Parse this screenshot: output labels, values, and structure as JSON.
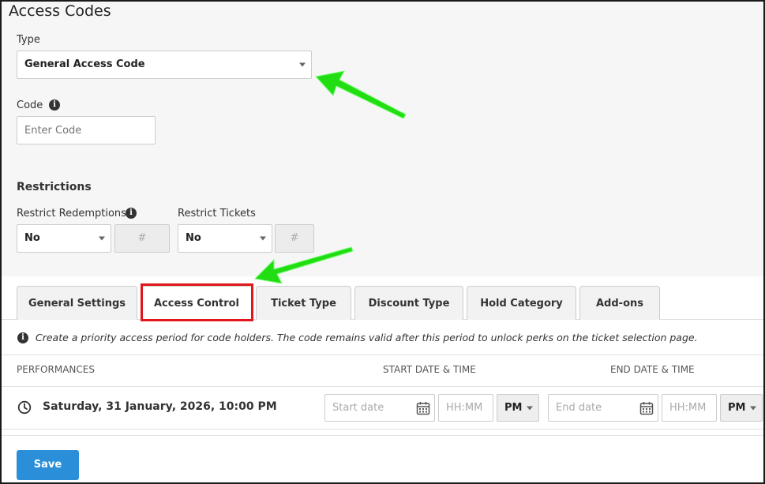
{
  "page": {
    "title": "Access Codes"
  },
  "type_field": {
    "label": "Type",
    "value": "General Access Code"
  },
  "code_field": {
    "label": "Code",
    "placeholder": "Enter Code",
    "info_icon": "i"
  },
  "restrictions": {
    "heading": "Restrictions",
    "redemptions": {
      "label": "Restrict Redemptions",
      "value": "No",
      "count_placeholder": "#",
      "info_icon": "i"
    },
    "tickets": {
      "label": "Restrict Tickets",
      "value": "No",
      "count_placeholder": "#"
    }
  },
  "tabs": [
    {
      "label": "General Settings"
    },
    {
      "label": "Access Control"
    },
    {
      "label": "Ticket Type"
    },
    {
      "label": "Discount Type"
    },
    {
      "label": "Hold Category"
    },
    {
      "label": "Add-ons"
    }
  ],
  "notice": {
    "icon": "i",
    "text": "Create a priority access period for code holders. The code remains valid after this period to unlock perks on the ticket selection page."
  },
  "table": {
    "headers": {
      "performances": "PERFORMANCES",
      "start": "START DATE & TIME",
      "end": "END DATE & TIME"
    },
    "row": {
      "performance": "Saturday, 31 January, 2026, 10:00 PM",
      "start_date_placeholder": "Start date",
      "start_time_placeholder": "HH:MM",
      "start_ampm": "PM",
      "end_date_placeholder": "End date",
      "end_time_placeholder": "HH:MM",
      "end_ampm": "PM"
    }
  },
  "save_button": {
    "label": "Save"
  },
  "colors": {
    "accent": "#2a8fd8",
    "highlight": "#e0161b",
    "arrow": "#22dd11"
  }
}
